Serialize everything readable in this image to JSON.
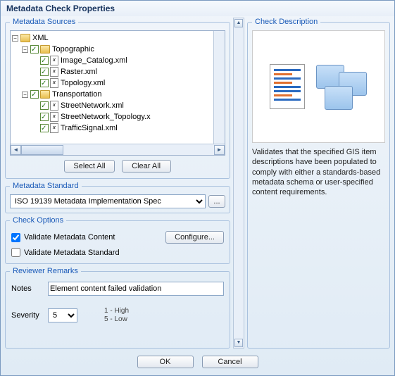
{
  "title": "Metadata Check Properties",
  "sources": {
    "legend": "Metadata Sources",
    "tree": {
      "root": "XML",
      "groups": [
        {
          "name": "Topographic",
          "items": [
            "Image_Catalog.xml",
            "Raster.xml",
            "Topology.xml"
          ]
        },
        {
          "name": "Transportation",
          "items": [
            "StreetNetwork.xml",
            "StreetNetwork_Topology.x",
            "TrafficSignal.xml"
          ]
        }
      ]
    },
    "select_all": "Select All",
    "clear_all": "Clear All"
  },
  "standard": {
    "legend": "Metadata Standard",
    "value": "ISO 19139 Metadata Implementation Spec",
    "browse": "..."
  },
  "options": {
    "legend": "Check Options",
    "validate_content": "Validate Metadata Content",
    "validate_standard": "Validate Metadata Standard",
    "configure": "Configure..."
  },
  "reviewer": {
    "legend": "Reviewer Remarks",
    "notes_label": "Notes",
    "notes_value": "Element content failed validation",
    "severity_label": "Severity",
    "severity_value": "5",
    "hint_high": "1 - High",
    "hint_low": "5 - Low"
  },
  "description": {
    "legend": "Check Description",
    "text": "Validates that the specified GIS item descriptions have been populated to comply with either a standards-based metadata schema or user-specified content requirements."
  },
  "footer": {
    "ok": "OK",
    "cancel": "Cancel"
  }
}
